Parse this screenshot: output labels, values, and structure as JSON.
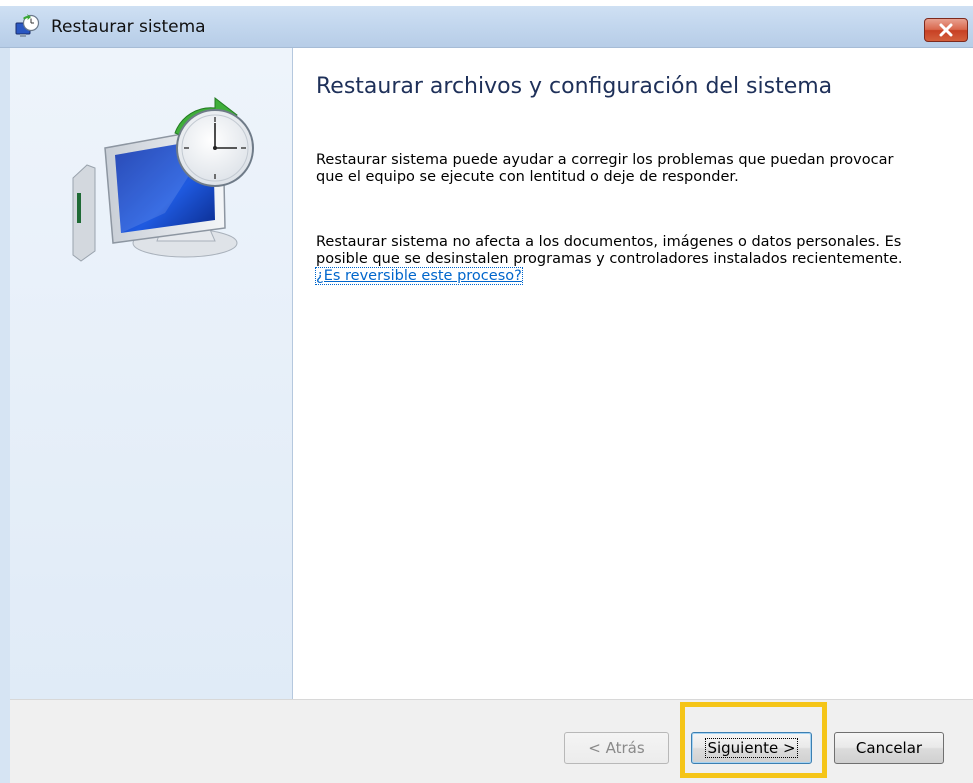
{
  "window": {
    "title": "Restaurar sistema",
    "title_icon": "system-restore-icon",
    "close_icon": "close-icon"
  },
  "sidebar": {
    "image": "system-restore-monitor-clock-icon"
  },
  "main": {
    "heading": "Restaurar archivos y configuración del sistema",
    "paragraph1": "Restaurar sistema puede ayudar a corregir los problemas que puedan provocar que el equipo se ejecute con lentitud o deje de responder.",
    "paragraph2_text": "Restaurar sistema no afecta a los documentos, imágenes o datos personales. Es posible que se desinstalen programas y controladores instalados recientemente. ",
    "paragraph2_link": "¿Es reversible este proceso?"
  },
  "footer": {
    "back_label": "< Atrás",
    "next_label": "Siguiente >",
    "cancel_label": "Cancelar"
  },
  "colors": {
    "highlight": "#f5c518",
    "heading": "#1e3059",
    "link": "#0066cc"
  }
}
